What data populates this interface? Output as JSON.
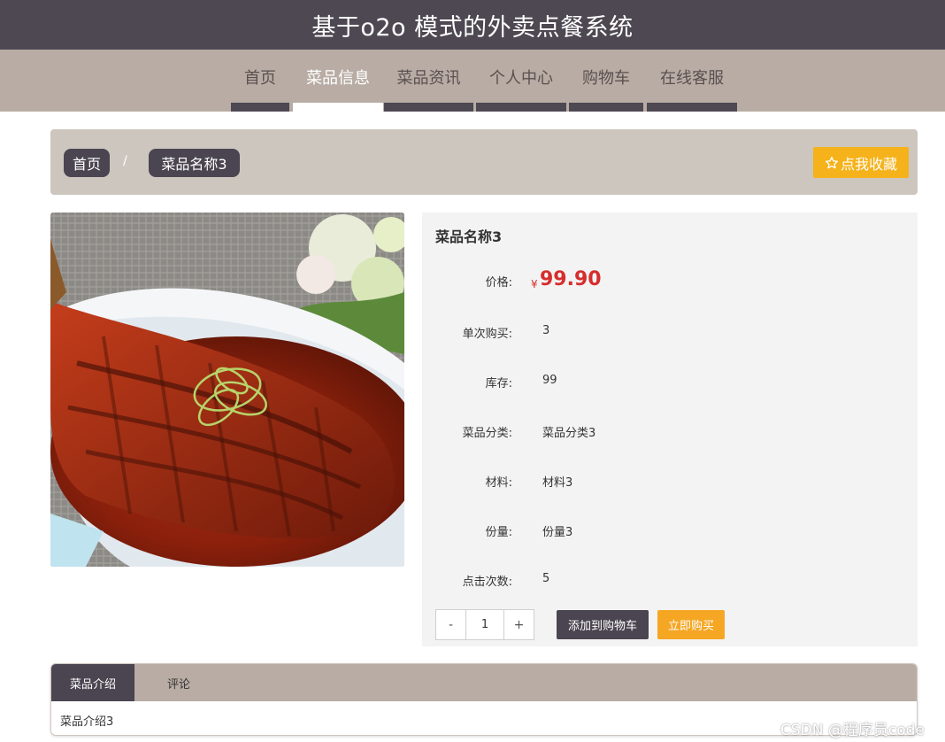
{
  "header": {
    "title": "基于o2o 模式的外卖点餐系统"
  },
  "nav": {
    "items": [
      {
        "label": "首页",
        "active": false
      },
      {
        "label": "菜品信息",
        "active": true
      },
      {
        "label": "菜品资讯",
        "active": false
      },
      {
        "label": "个人中心",
        "active": false
      },
      {
        "label": "购物车",
        "active": false
      },
      {
        "label": "在线客服",
        "active": false
      }
    ]
  },
  "breadcrumb": {
    "home": "首页",
    "separator": "/",
    "current": "菜品名称3",
    "favorite_label": "点我收藏",
    "favorite_icon": "star-outline-icon"
  },
  "dish": {
    "name": "菜品名称3",
    "price_label": "价格:",
    "currency": "¥",
    "price": "99.90",
    "fields": [
      {
        "label": "单次购买:",
        "value": "3"
      },
      {
        "label": "库存:",
        "value": "99"
      },
      {
        "label": "菜品分类:",
        "value": "菜品分类3"
      },
      {
        "label": "材料:",
        "value": "材料3"
      },
      {
        "label": "份量:",
        "value": "份量3"
      },
      {
        "label": "点击次数:",
        "value": "5"
      }
    ]
  },
  "purchase": {
    "minus": "-",
    "quantity": "1",
    "plus": "+",
    "add_to_cart": "添加到购物车",
    "buy_now": "立即购买"
  },
  "tabs": {
    "items": [
      {
        "label": "菜品介绍",
        "active": true
      },
      {
        "label": "评论",
        "active": false
      }
    ],
    "content": "菜品介绍3"
  },
  "watermark": "CSDN @程序员code",
  "colors": {
    "header_bg": "#4d4852",
    "nav_bg": "#b8aca4",
    "accent_dark": "#4a4550",
    "favorite_yellow": "#f5b21a",
    "buy_orange": "#f5a623",
    "price_red": "#d62d2d"
  }
}
